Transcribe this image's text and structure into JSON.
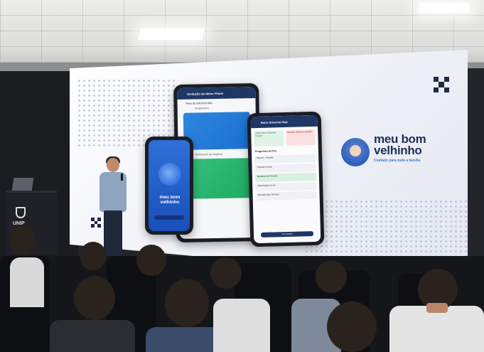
{
  "screen": {
    "phone_left": {
      "title": "meu bom velhinho"
    },
    "phone_middle": {
      "header": "Evolução do Idoso Vilson",
      "subtitle": "Área de Glicemia Mês",
      "label_top": "Temperatura",
      "label_bottom": "Informação de Oxigênio"
    },
    "phone_right": {
      "header": "Barra Glicemia Hoje",
      "card_ok": "Idoso Vilson Glicemia normal",
      "card_alert": "Atenção Glicemia elevada",
      "section": "Progresso do Dia",
      "rows": [
        "Glicose / Pressão",
        "Pressão normal",
        "Mudança de Pressão",
        "Alimentação do dia",
        "Remédio das 18 horas"
      ],
      "button": "Ver resumo"
    },
    "logo": {
      "name_line1": "meu bom",
      "name_line2": "velhinho",
      "tagline": "Cuidado para toda a família"
    }
  },
  "podium": {
    "text": "UNIP"
  },
  "colors": {
    "navy": "#1f3764",
    "brand_blue": "#2f6fd8",
    "brand_green": "#34c27a",
    "logo_text": "#1f2f55"
  }
}
